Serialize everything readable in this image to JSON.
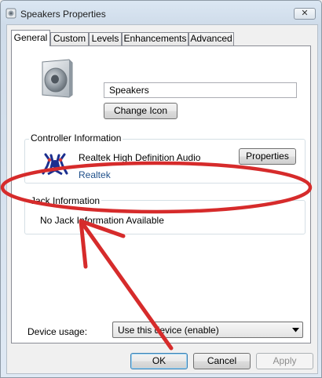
{
  "window": {
    "title": "Speakers Properties",
    "close_glyph": "✕"
  },
  "tabs": [
    {
      "label": "General",
      "active": true
    },
    {
      "label": "Custom",
      "active": false
    },
    {
      "label": "Levels",
      "active": false
    },
    {
      "label": "Enhancements",
      "active": false
    },
    {
      "label": "Advanced",
      "active": false
    }
  ],
  "general": {
    "device_name": "Speakers",
    "change_icon_label": "Change Icon",
    "controller": {
      "heading": "Controller Information",
      "name": "Realtek High Definition Audio",
      "vendor": "Realtek",
      "properties_label": "Properties"
    },
    "jack": {
      "heading": "Jack Information",
      "message": "No Jack Information Available"
    },
    "device_usage": {
      "label": "Device usage:",
      "selected": "Use this device (enable)"
    }
  },
  "footer": {
    "ok_label": "OK",
    "cancel_label": "Cancel",
    "apply_label": "Apply"
  },
  "colors": {
    "annotation_red": "#d62b2b",
    "link_blue": "#1e4f8a"
  }
}
